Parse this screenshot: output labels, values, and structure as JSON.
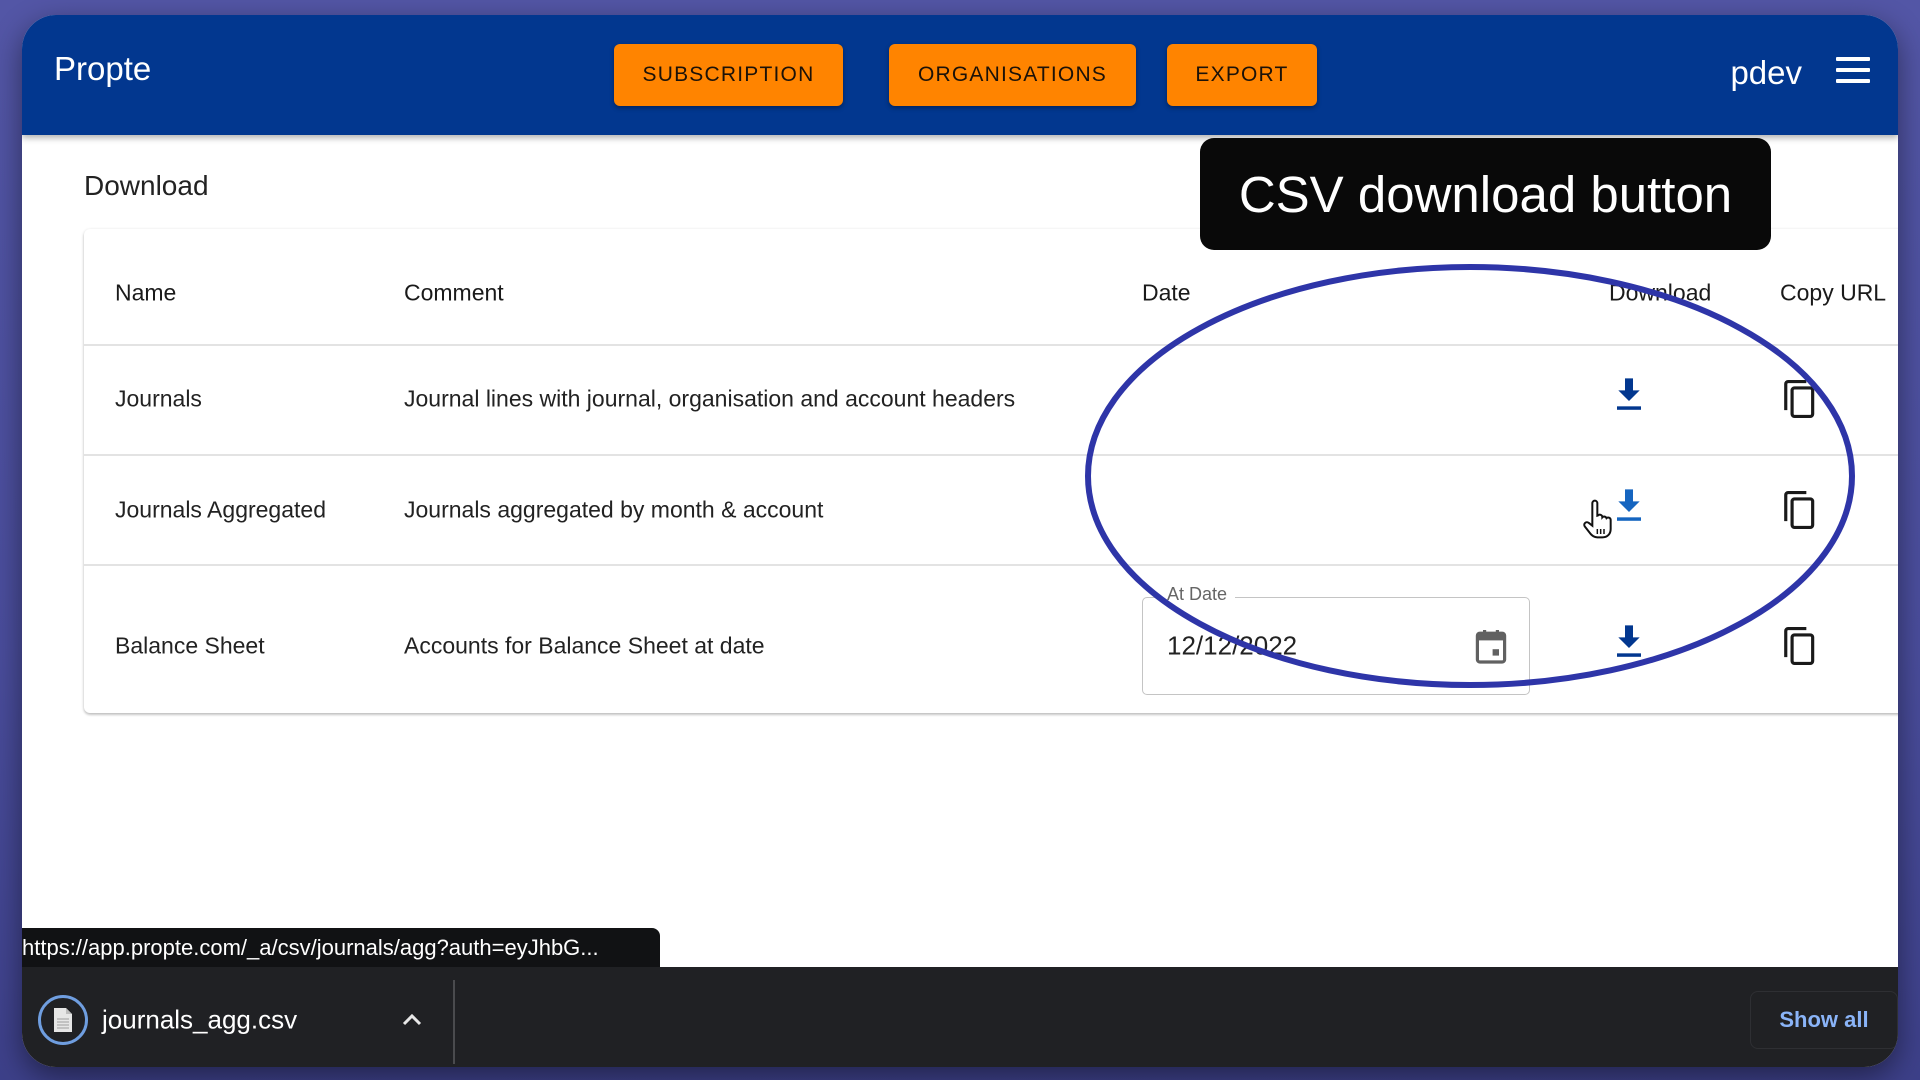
{
  "app": {
    "brand": "Propte",
    "nav": [
      {
        "label": "SUBSCRIPTION"
      },
      {
        "label": "ORGANISATIONS"
      },
      {
        "label": "EXPORT"
      }
    ],
    "user": "pdev",
    "menu_icon": "hamburger-menu-icon"
  },
  "page": {
    "title": "Download"
  },
  "table": {
    "columns": [
      "Name",
      "Comment",
      "Date",
      "Download",
      "Copy URL"
    ],
    "rows": [
      {
        "name": "Journals",
        "comment": "Journal lines with journal, organisation and account headers",
        "download_icon": "download-icon",
        "copy_icon": "copy-icon"
      },
      {
        "name": "Journals Aggregated",
        "comment": "Journals aggregated by month & account",
        "download_icon": "download-icon",
        "copy_icon": "copy-icon"
      },
      {
        "name": "Balance Sheet",
        "comment": "Accounts for Balance Sheet at date",
        "date_field": {
          "label": "At Date",
          "value": "12/12/2022",
          "icon": "calendar-icon"
        },
        "download_icon": "download-icon",
        "copy_icon": "copy-icon"
      }
    ]
  },
  "annotation": {
    "tooltip": "CSV download button",
    "highlight_color": "#2e35a8"
  },
  "browser": {
    "status_url": "https://app.propte.com/_a/csv/journals/agg?auth=eyJhbG...",
    "download_file": "journals_agg.csv",
    "show_all": "Show all"
  },
  "colors": {
    "appbar": "#02378f",
    "nav_button": "#ff8400",
    "download_icon": "#02378f",
    "download_bar": "#202124",
    "show_all": "#8ab4f8"
  }
}
